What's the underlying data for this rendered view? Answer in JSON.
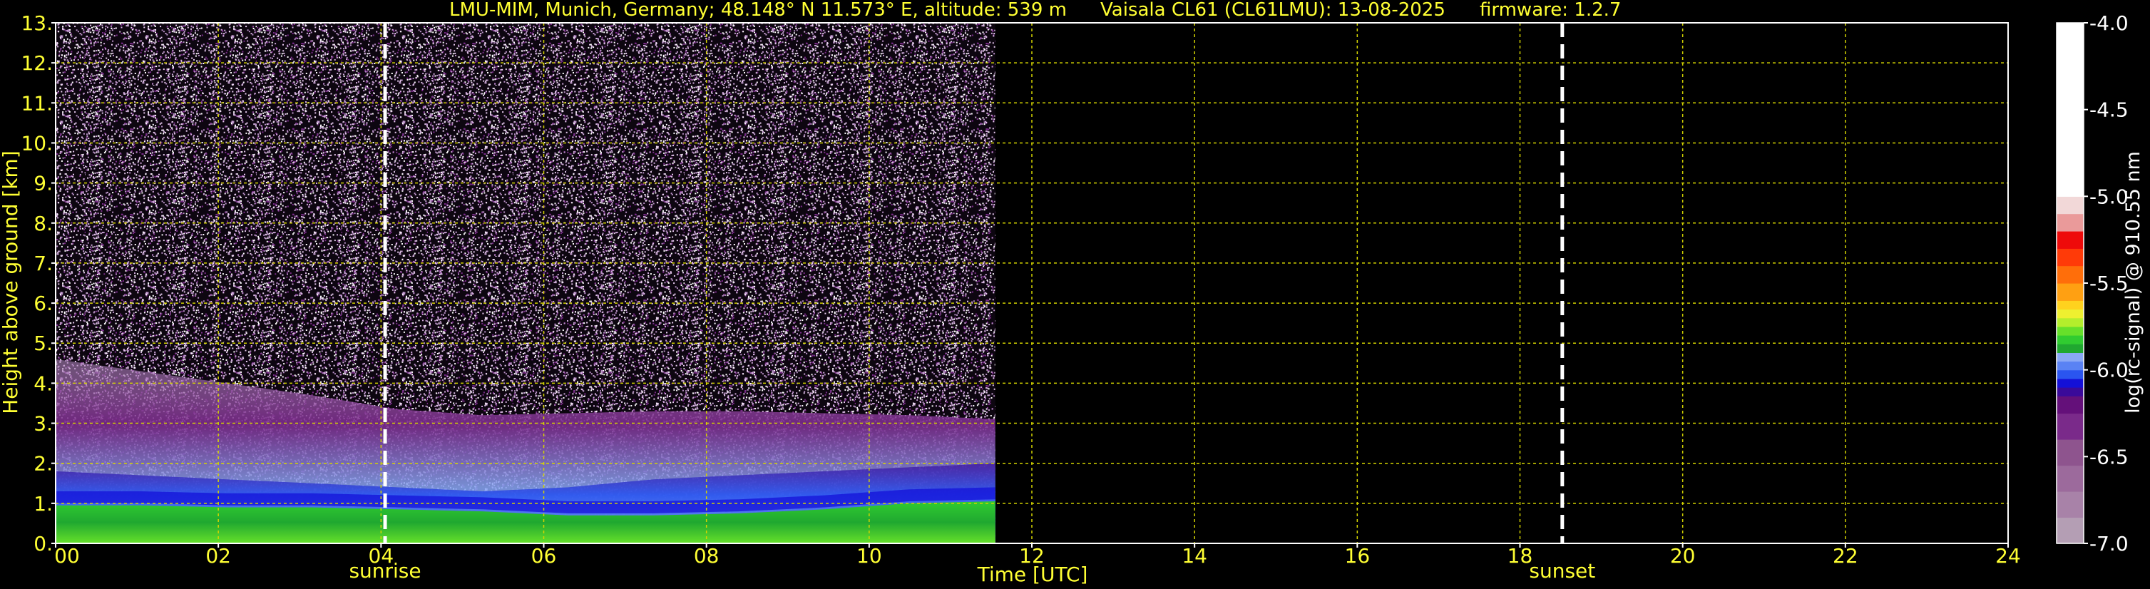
{
  "colors": {
    "background": "#000000",
    "text_yellow": "#ffff33",
    "grid": "#d4d400",
    "axis": "#ffffff",
    "marker": "#ffffff"
  },
  "chart_data": {
    "type": "heatmap",
    "title_parts": [
      "LMU-MIM, Munich, Germany; 48.148° N 11.573° E, altitude: 539 m",
      "Vaisala CL61 (CL61LMU): 13-08-2025",
      "firmware: 1.2.7"
    ],
    "xlabel": "Time [UTC]",
    "ylabel": "Height above ground [km]",
    "xlim": [
      0,
      24
    ],
    "ylim": [
      0,
      13
    ],
    "x_ticks": [
      0,
      2,
      4,
      6,
      8,
      10,
      12,
      14,
      16,
      18,
      20,
      22,
      24
    ],
    "x_tick_labels": [
      "00",
      "02",
      "04",
      "06",
      "08",
      "10",
      "12",
      "14",
      "16",
      "18",
      "20",
      "22",
      "24"
    ],
    "y_ticks": [
      0,
      1,
      2,
      3,
      4,
      5,
      6,
      7,
      8,
      9,
      10,
      11,
      12,
      13
    ],
    "y_tick_labels": [
      "0.",
      "1.",
      "2.",
      "3.",
      "4.",
      "5.",
      "6.",
      "7.",
      "8.",
      "9.",
      "10.",
      "11.",
      "12.",
      "13."
    ],
    "grid": true,
    "data_end_time": 11.55,
    "sunrise": {
      "label": "sunrise",
      "time": 4.05
    },
    "sunset": {
      "label": "sunset",
      "time": 18.52
    },
    "layers": {
      "aerosol_top_km": [
        4.6,
        4.3,
        4.0,
        3.7,
        3.35,
        3.2,
        3.25,
        3.3,
        3.3,
        3.25,
        3.2,
        3.1
      ],
      "boundary_layer_km": [
        1.8,
        1.7,
        1.6,
        1.5,
        1.4,
        1.3,
        1.4,
        1.6,
        1.7,
        1.8,
        1.9,
        2.0
      ],
      "surface_green_top_km": [
        0.95,
        0.95,
        0.9,
        0.9,
        0.85,
        0.8,
        0.7,
        0.7,
        0.75,
        0.85,
        1.0,
        1.05
      ]
    },
    "colorbar": {
      "label": "log(rc-signal) @ 910.55 nm",
      "min": -7.0,
      "max": -4.0,
      "ticks": [
        -4.0,
        -4.5,
        -5.0,
        -5.5,
        -6.0,
        -6.5,
        -7.0
      ],
      "tick_labels": [
        "-4.0",
        "-4.5",
        "-5.0",
        "-5.5",
        "-6.0",
        "-6.5",
        "-7.0"
      ],
      "levels": [
        {
          "from": -7.0,
          "to": -6.85,
          "color": "#b49eb4"
        },
        {
          "from": -6.85,
          "to": -6.7,
          "color": "#a882a8"
        },
        {
          "from": -6.7,
          "to": -6.55,
          "color": "#9c6a9c"
        },
        {
          "from": -6.55,
          "to": -6.4,
          "color": "#8e548e"
        },
        {
          "from": -6.4,
          "to": -6.25,
          "color": "#7a2a8a"
        },
        {
          "from": -6.25,
          "to": -6.15,
          "color": "#64107a"
        },
        {
          "from": -6.15,
          "to": -6.1,
          "color": "#3a0a9a"
        },
        {
          "from": -6.1,
          "to": -6.05,
          "color": "#1410d8"
        },
        {
          "from": -6.05,
          "to": -6.0,
          "color": "#2a55f0"
        },
        {
          "from": -6.0,
          "to": -5.95,
          "color": "#5a82f4"
        },
        {
          "from": -5.95,
          "to": -5.9,
          "color": "#8aa8f6"
        },
        {
          "from": -5.9,
          "to": -5.85,
          "color": "#20a830"
        },
        {
          "from": -5.85,
          "to": -5.8,
          "color": "#30cc30"
        },
        {
          "from": -5.8,
          "to": -5.75,
          "color": "#66e02a"
        },
        {
          "from": -5.75,
          "to": -5.7,
          "color": "#b4ee2c"
        },
        {
          "from": -5.7,
          "to": -5.65,
          "color": "#eef030"
        },
        {
          "from": -5.65,
          "to": -5.6,
          "color": "#ffd21e"
        },
        {
          "from": -5.6,
          "to": -5.5,
          "color": "#ffa012"
        },
        {
          "from": -5.5,
          "to": -5.4,
          "color": "#ff6e0a"
        },
        {
          "from": -5.4,
          "to": -5.3,
          "color": "#ff3a08"
        },
        {
          "from": -5.3,
          "to": -5.2,
          "color": "#ee0a0a"
        },
        {
          "from": -5.2,
          "to": -5.1,
          "color": "#ea9a9a"
        },
        {
          "from": -5.1,
          "to": -5.0,
          "color": "#f2d8d8"
        },
        {
          "from": -5.0,
          "to": -4.0,
          "color": "#ffffff"
        }
      ]
    }
  }
}
